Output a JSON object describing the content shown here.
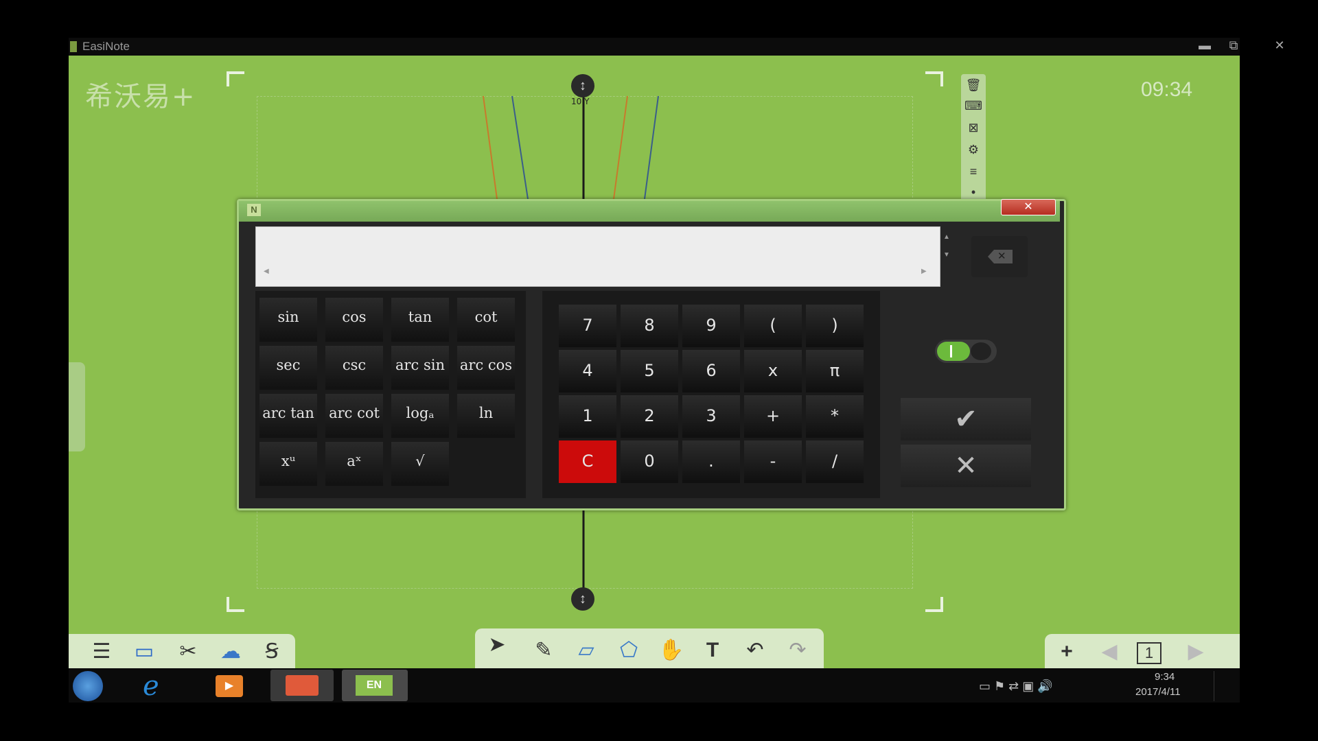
{
  "window": {
    "title": "EasiNote",
    "minimize": "▬",
    "restore": "⧉",
    "close": "✕"
  },
  "brand": {
    "logo_text": "希沃易+"
  },
  "clock": "09:34",
  "graph": {
    "axis_label": "10 Y"
  },
  "right_toolbar": {
    "icons": [
      "trash-icon",
      "keyboard-icon",
      "close-box-icon",
      "gear-icon",
      "list-icon",
      "more-icon"
    ]
  },
  "calculator": {
    "badge": "N",
    "close": "✕",
    "display_value": "",
    "functions": [
      [
        "sin",
        "cos",
        "tan",
        "cot"
      ],
      [
        "sec",
        "csc",
        "arc sin",
        "arc cos"
      ],
      [
        "arc tan",
        "arc cot",
        "logₐ",
        "ln"
      ],
      [
        "xᵘ",
        "aˣ",
        "√",
        ""
      ]
    ],
    "keys": [
      [
        "7",
        "8",
        "9",
        "(",
        ")"
      ],
      [
        "4",
        "5",
        "6",
        "x",
        "π"
      ],
      [
        "1",
        "2",
        "3",
        "+",
        "*"
      ],
      [
        "C",
        "0",
        ".",
        "-",
        "/"
      ]
    ],
    "confirm": "✔",
    "cancel": "✕",
    "colors": {
      "clear_key": "#cc0b0b",
      "toggle_on": "#6cba3c",
      "frame": "#a7d07f"
    }
  },
  "bottom_toolbar": {
    "left": [
      "menu-icon",
      "desktop-icon",
      "tools-icon",
      "cloud-icon",
      "text-mode-icon"
    ],
    "middle": [
      "select-arrow-icon",
      "pen-icon",
      "eraser-icon",
      "shape-icon",
      "hand-icon",
      "text-icon",
      "undo-icon",
      "redo-icon"
    ],
    "right": {
      "add": "+",
      "page": "1"
    }
  },
  "taskbar": {
    "apps": [
      "start-orb",
      "ie-icon",
      "media-player-icon",
      "easinote-icon",
      "en-icon"
    ],
    "en_label": "EN",
    "time": "9:34",
    "date": "2017/4/11"
  }
}
